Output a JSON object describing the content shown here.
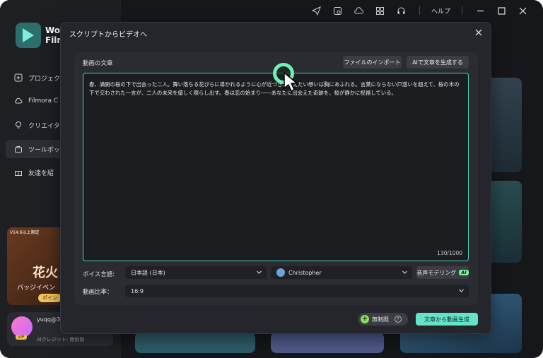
{
  "topbar": {
    "icons": [
      "send-icon",
      "project-icon",
      "cloud-icon",
      "grid-icon",
      "headset-icon"
    ],
    "help_label": "ヘルプ"
  },
  "sidebar": {
    "logo_text": "Wo\nFilm",
    "items": [
      {
        "label": "プロジェク",
        "icon": "plus-square-icon"
      },
      {
        "label": "Filmora C",
        "icon": "cloud-icon"
      },
      {
        "label": "クリエイタ",
        "icon": "bulb-icon"
      },
      {
        "label": "ツールボッ",
        "icon": "toolbox-icon",
        "active": true
      },
      {
        "label": "友達を紹",
        "icon": "gift-icon"
      }
    ],
    "promo": {
      "tag": "V14.6以上限定",
      "big": "花火",
      "sub": "バッジイベン",
      "button": "ポイン"
    },
    "user": {
      "name": "yuqq@30",
      "vip": "VIP",
      "credit": "AIクレジット: 無制限"
    }
  },
  "dialog": {
    "title": "スクリプトからビデオへ",
    "section_label": "動画の文章",
    "import_button": "ファイルのインポート",
    "ai_generate_button": "AIで文章を生成する",
    "script_text": "春、満開の桜の下で出会った二人。舞い落ちる花びらに導かれるように心が近づき、伝えたい想いは胸にあふれる。言葉にならない戸惑いを超えて、桜の木の下で交わされた一言が、二人の未来を優しく照らし出す。春は恋の始まり――あなたに出会えた奇跡を、桜が静かに祝福している。",
    "char_count": "130/1000",
    "voice_language_label": "ボイス言語:",
    "voice_language_value": "日本語 (日本)",
    "voice_name": "Christopher",
    "voice_model_button": "音声モデリング",
    "ai_badge": "AI",
    "ratio_label": "動画比率：",
    "ratio_value": "16:9",
    "unlimited_label": "無制限",
    "create_button": "文章から動画生成"
  },
  "colors": {
    "accent": "#64e4c5",
    "border_focus": "#4fd1b5",
    "ai_badge": "#7ef0a0"
  }
}
